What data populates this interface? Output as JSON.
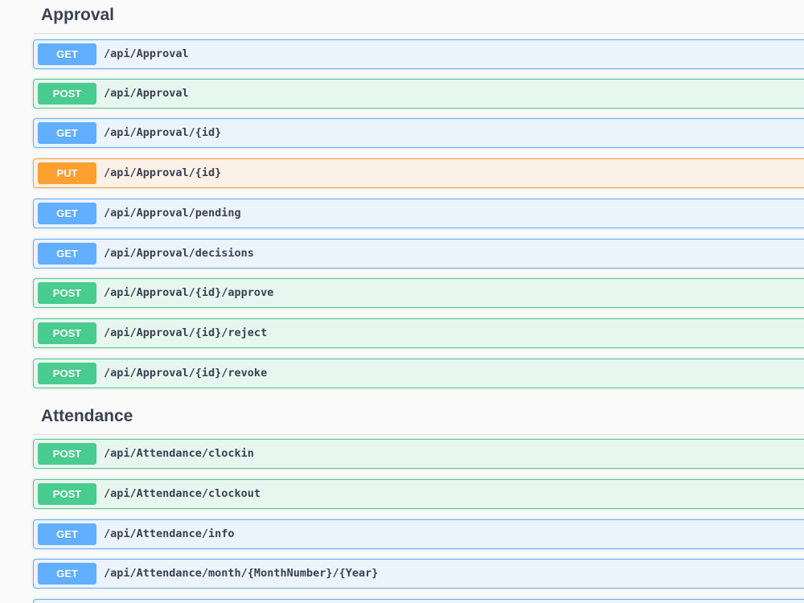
{
  "sections": [
    {
      "title": "Approval",
      "operations": [
        {
          "method": "GET",
          "path": "/api/Approval"
        },
        {
          "method": "POST",
          "path": "/api/Approval"
        },
        {
          "method": "GET",
          "path": "/api/Approval/{id}"
        },
        {
          "method": "PUT",
          "path": "/api/Approval/{id}"
        },
        {
          "method": "GET",
          "path": "/api/Approval/pending"
        },
        {
          "method": "GET",
          "path": "/api/Approval/decisions"
        },
        {
          "method": "POST",
          "path": "/api/Approval/{id}/approve"
        },
        {
          "method": "POST",
          "path": "/api/Approval/{id}/reject"
        },
        {
          "method": "POST",
          "path": "/api/Approval/{id}/revoke"
        }
      ]
    },
    {
      "title": "Attendance",
      "operations": [
        {
          "method": "POST",
          "path": "/api/Attendance/clockin"
        },
        {
          "method": "POST",
          "path": "/api/Attendance/clockout"
        },
        {
          "method": "GET",
          "path": "/api/Attendance/info"
        },
        {
          "method": "GET",
          "path": "/api/Attendance/month/{MonthNumber}/{Year}"
        }
      ]
    }
  ],
  "colors": {
    "get": "#61affe",
    "post": "#49cc90",
    "put": "#fca130",
    "text": "#3b4151"
  }
}
